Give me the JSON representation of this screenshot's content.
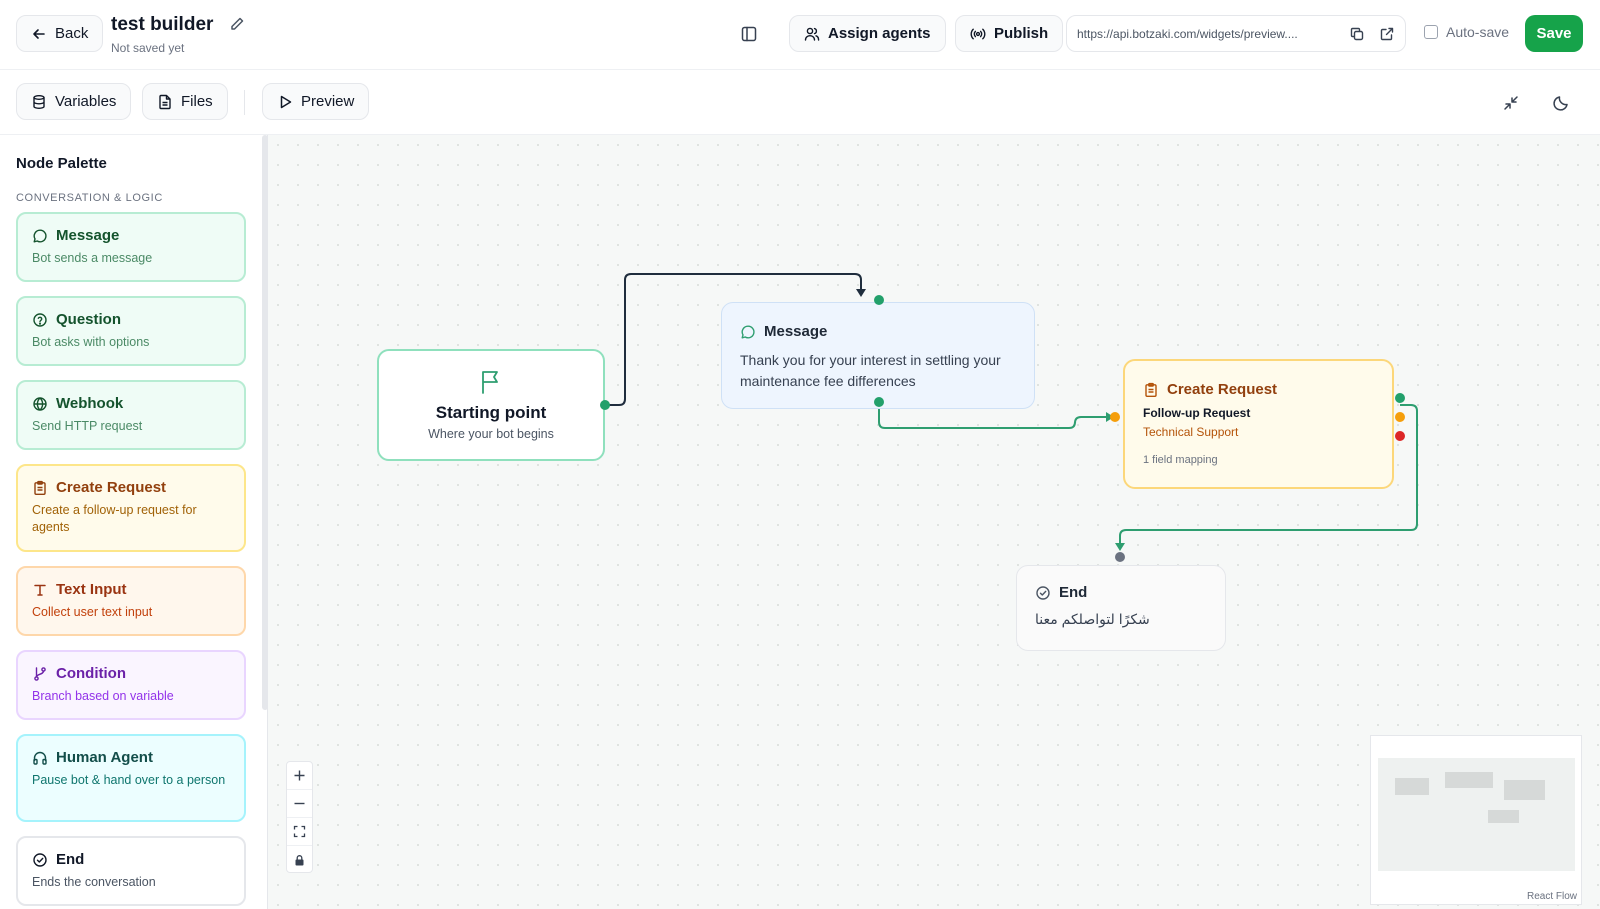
{
  "header": {
    "back_label": "Back",
    "title": "test builder",
    "subtitle": "Not saved yet",
    "assign_label": "Assign agents",
    "publish_label": "Publish",
    "url": "https://api.botzaki.com/widgets/preview....",
    "autosave_label": "Auto-save",
    "save_label": "Save"
  },
  "toolbar": {
    "variables_label": "Variables",
    "files_label": "Files",
    "preview_label": "Preview"
  },
  "palette": {
    "title": "Node Palette",
    "section": "CONVERSATION & LOGIC",
    "items": [
      {
        "label": "Message",
        "desc": "Bot sends a message",
        "icon": "chat-bubble-icon"
      },
      {
        "label": "Question",
        "desc": "Bot asks with options",
        "icon": "help-circle-icon"
      },
      {
        "label": "Webhook",
        "desc": "Send HTTP request",
        "icon": "webhook-icon"
      },
      {
        "label": "Create Request",
        "desc": "Create a follow-up request for agents",
        "icon": "clipboard-icon"
      },
      {
        "label": "Text Input",
        "desc": "Collect user text input",
        "icon": "type-icon"
      },
      {
        "label": "Condition",
        "desc": "Branch based on variable",
        "icon": "git-branch-icon"
      },
      {
        "label": "Human Agent",
        "desc": "Pause bot & hand over to a person",
        "icon": "headphones-icon"
      },
      {
        "label": "End",
        "desc": "Ends the conversation",
        "icon": "check-circle-icon"
      }
    ]
  },
  "nodes": {
    "start": {
      "title": "Starting point",
      "subtitle": "Where your bot begins"
    },
    "message": {
      "title": "Message",
      "text": "Thank you for your interest in settling your maintenance fee differences"
    },
    "request": {
      "title": "Create Request",
      "name": "Follow-up Request",
      "department": "Technical Support",
      "mapping": "1 field mapping"
    },
    "end": {
      "title": "End",
      "text": "شكرًا لتواصلكم معنا"
    }
  },
  "canvas": {
    "attribution": "React Flow"
  },
  "colors": {
    "accent_green": "#16a34a",
    "edge_dark": "#1f2d3d",
    "edge_green": "#2e9e70",
    "handle_green": "#22a06b",
    "handle_amber": "#f59e0b",
    "handle_red": "#dc2626",
    "handle_gray": "#6b7280"
  }
}
